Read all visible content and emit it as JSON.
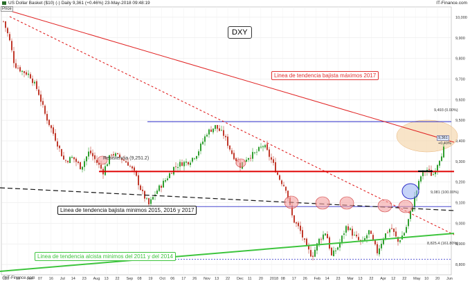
{
  "header": {
    "left": "US Dollar Basket ($10) (-)   Daily   9,361 (+0.46%)   23-May-2018 09:48:19",
    "right": "IT-Finance.com",
    "price_tag": "Price",
    "footer": "@IT-Finance.com"
  },
  "annotations": {
    "title_box": "DXY",
    "red_trend": "Linea de tendencia bajista máximos 2017",
    "black_trend": "Linea de tendencia bajista minimos 2015, 2016 y 2017",
    "green_trend": "Linea de tendencia alcista minimos del 2011 y del 2014",
    "resistance": "Resistencia (9,251.2)",
    "level_top": "9,493 (0.00%)",
    "level_mid": "9,081 (100.00%)",
    "level_low": "8,825.4 (161.80%)",
    "last_price": "9,361",
    "change": "+0.40%"
  },
  "colors": {
    "up": "#2e9e2e",
    "down": "#c0392b",
    "red_line": "#e02020",
    "black_line": "#111111",
    "green_line": "#3cc43c",
    "blue_line": "#2b2bc8",
    "resistance": "#e00000"
  },
  "chart_data": {
    "type": "candlestick",
    "title": "DXY",
    "ylim": [
      8750,
      10050
    ],
    "y_ticks": [
      "10,000",
      "9,900",
      "9,800",
      "9,700",
      "9,600",
      "9,500",
      "9,400",
      "9,300",
      "9,200",
      "9,100",
      "9,000",
      "8,900",
      "8,800"
    ],
    "y_tick_values": [
      10000,
      9900,
      9800,
      9700,
      9600,
      9500,
      9400,
      9300,
      9200,
      9100,
      9000,
      8900,
      8800
    ],
    "x_ticks": [
      "10",
      "19",
      "Jun",
      "07",
      "16",
      "Jul",
      "14",
      "23",
      "Aug",
      "13",
      "22",
      "Sep",
      "08",
      "19",
      "Oct",
      "06",
      "17",
      "26",
      "Nov",
      "13",
      "22",
      "Dec",
      "11",
      "20",
      "2018",
      "08",
      "17",
      "26",
      "Feb",
      "14",
      "23",
      "Mar",
      "13",
      "22",
      "Apr",
      "12",
      "22",
      "May",
      "10",
      "20",
      "Jun"
    ],
    "close_path": [
      {
        "t": 0,
        "v": 9980
      },
      {
        "t": 8,
        "v": 9900
      },
      {
        "t": 16,
        "v": 9770
      },
      {
        "t": 26,
        "v": 9740
      },
      {
        "t": 38,
        "v": 9720
      },
      {
        "t": 50,
        "v": 9640
      },
      {
        "t": 60,
        "v": 9530
      },
      {
        "t": 74,
        "v": 9420
      },
      {
        "t": 88,
        "v": 9300
      },
      {
        "t": 100,
        "v": 9320
      },
      {
        "t": 112,
        "v": 9270
      },
      {
        "t": 124,
        "v": 9350
      },
      {
        "t": 134,
        "v": 9300
      },
      {
        "t": 144,
        "v": 9250
      },
      {
        "t": 156,
        "v": 9340
      },
      {
        "t": 168,
        "v": 9320
      },
      {
        "t": 180,
        "v": 9290
      },
      {
        "t": 190,
        "v": 9240
      },
      {
        "t": 200,
        "v": 9150
      },
      {
        "t": 210,
        "v": 9090
      },
      {
        "t": 222,
        "v": 9160
      },
      {
        "t": 234,
        "v": 9210
      },
      {
        "t": 246,
        "v": 9270
      },
      {
        "t": 256,
        "v": 9290
      },
      {
        "t": 268,
        "v": 9300
      },
      {
        "t": 280,
        "v": 9340
      },
      {
        "t": 294,
        "v": 9440
      },
      {
        "t": 306,
        "v": 9470
      },
      {
        "t": 318,
        "v": 9430
      },
      {
        "t": 330,
        "v": 9340
      },
      {
        "t": 342,
        "v": 9280
      },
      {
        "t": 352,
        "v": 9320
      },
      {
        "t": 364,
        "v": 9340
      },
      {
        "t": 376,
        "v": 9380
      },
      {
        "t": 388,
        "v": 9300
      },
      {
        "t": 398,
        "v": 9220
      },
      {
        "t": 408,
        "v": 9170
      },
      {
        "t": 418,
        "v": 9020
      },
      {
        "t": 428,
        "v": 8970
      },
      {
        "t": 438,
        "v": 8880
      },
      {
        "t": 446,
        "v": 8840
      },
      {
        "t": 456,
        "v": 8920
      },
      {
        "t": 466,
        "v": 8960
      },
      {
        "t": 474,
        "v": 8840
      },
      {
        "t": 484,
        "v": 8890
      },
      {
        "t": 496,
        "v": 8990
      },
      {
        "t": 506,
        "v": 8940
      },
      {
        "t": 518,
        "v": 8900
      },
      {
        "t": 528,
        "v": 8960
      },
      {
        "t": 540,
        "v": 8860
      },
      {
        "t": 550,
        "v": 8940
      },
      {
        "t": 560,
        "v": 8980
      },
      {
        "t": 570,
        "v": 8910
      },
      {
        "t": 580,
        "v": 8960
      },
      {
        "t": 588,
        "v": 9050
      },
      {
        "t": 596,
        "v": 9150
      },
      {
        "t": 604,
        "v": 9240
      },
      {
        "t": 612,
        "v": 9260
      },
      {
        "t": 620,
        "v": 9230
      },
      {
        "t": 628,
        "v": 9300
      },
      {
        "t": 636,
        "v": 9361
      }
    ],
    "horizontal_levels": [
      {
        "name": "resistance",
        "value": 9251.2
      },
      {
        "name": "fib_0",
        "value": 9493
      },
      {
        "name": "fib_100",
        "value": 9081
      },
      {
        "name": "fib_161.8",
        "value": 8825.4
      }
    ]
  }
}
